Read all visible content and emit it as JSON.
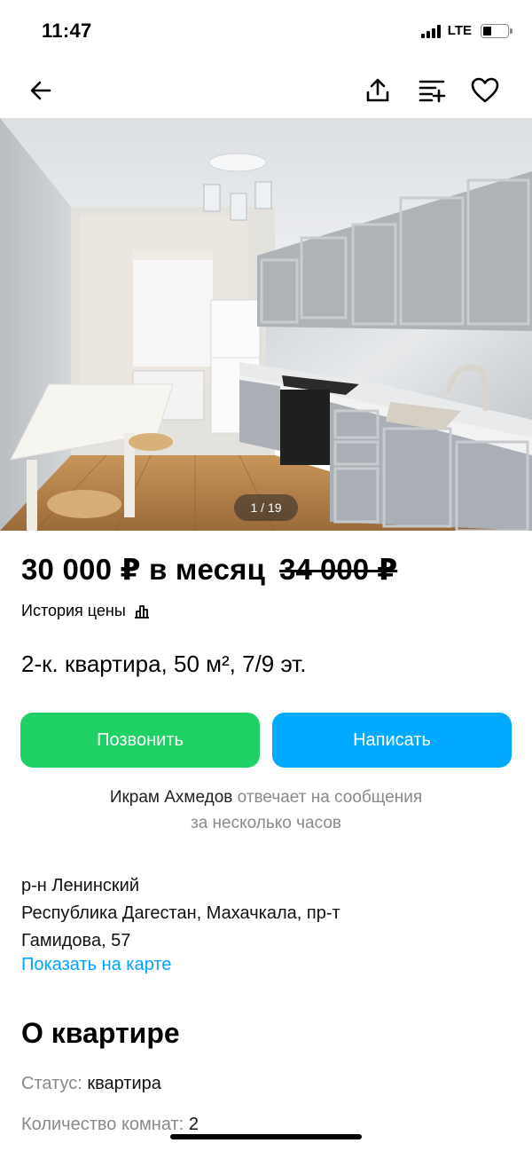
{
  "status_bar": {
    "time": "11:47",
    "network": "LTE"
  },
  "nav": {
    "back_icon": "arrow-left-icon",
    "share_icon": "share-upload-icon",
    "compare_icon": "compare-list-icon",
    "favorite_icon": "heart-icon"
  },
  "gallery": {
    "counter": "1 / 19"
  },
  "listing": {
    "price": "30 000 ₽ в месяц",
    "old_price": "34 000 ₽",
    "price_history_label": "История цены",
    "title": "2-к. квартира, 50 м², 7/9 эт."
  },
  "actions": {
    "call_label": "Позвонить",
    "write_label": "Написать",
    "call_color": "#1fd165",
    "write_color": "#00aaff"
  },
  "seller": {
    "name": "Икрам Ахмедов",
    "response_text": " отвечает на сообщения",
    "response_time": "за несколько часов"
  },
  "location": {
    "district": "р-н Ленинский",
    "address_line1": "Республика Дагестан, Махачкала, пр-т",
    "address_line2": "Гамидова, 57",
    "map_link": "Показать на карте"
  },
  "about": {
    "section_title": "О квартире",
    "params": [
      {
        "key": "Статус:",
        "value": "квартира"
      },
      {
        "key": "Количество комнат:",
        "value": "2"
      }
    ]
  },
  "colors": {
    "link": "#00a3ff",
    "muted_text": "#8a8a8a"
  }
}
